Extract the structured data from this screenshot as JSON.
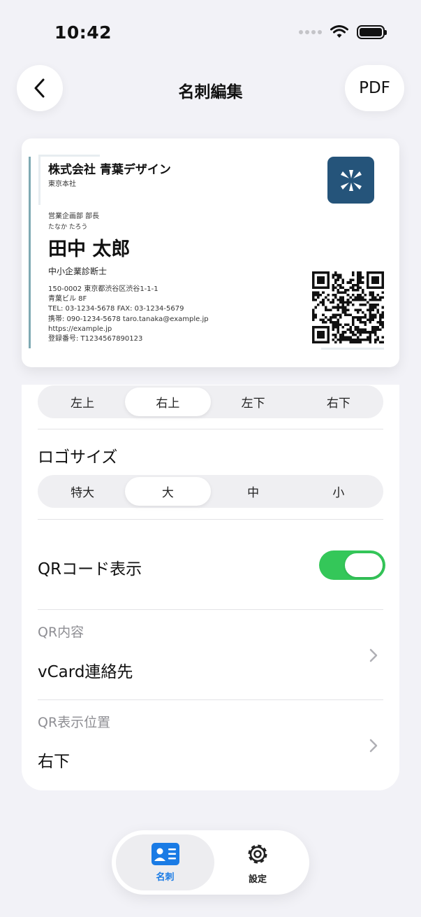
{
  "status": {
    "time": "10:42"
  },
  "nav": {
    "title": "名刺編集",
    "pdf_label": "PDF"
  },
  "card": {
    "company": "株式会社 青葉デザイン",
    "branch": "東京本社",
    "department": "営業企画部 部長",
    "kana": "たなか たろう",
    "name": "田中 太郎",
    "qualification": "中小企業診断士",
    "info_lines": [
      "150-0002 東京都渋谷区渋谷1-1-1",
      "青葉ビル 8F",
      "TEL: 03-1234-5678  FAX: 03-1234-5679",
      "携帯: 090-1234-5678  taro.tanaka@example.jp",
      "https://example.jp",
      "登録番号: T1234567890123"
    ],
    "logo_color": "#25547a",
    "accent_color": "#7fa9b3"
  },
  "settings": {
    "logo_position": {
      "options": [
        "左上",
        "右上",
        "左下",
        "右下"
      ],
      "selected": "右上"
    },
    "logo_size": {
      "label": "ロゴサイズ",
      "options": [
        "特大",
        "大",
        "中",
        "小"
      ],
      "selected": "大"
    },
    "qr_toggle": {
      "label": "QRコード表示",
      "on": true,
      "color": "#34c759"
    },
    "qr_content": {
      "label": "QR内容",
      "value": "vCard連絡先"
    },
    "qr_position": {
      "label": "QR表示位置",
      "value": "右下"
    }
  },
  "tabbar": {
    "tabs": [
      {
        "label": "名刺",
        "icon": "id-card-icon",
        "active": true
      },
      {
        "label": "設定",
        "icon": "gear-icon",
        "active": false
      }
    ],
    "active_color": "#1a7be5"
  }
}
